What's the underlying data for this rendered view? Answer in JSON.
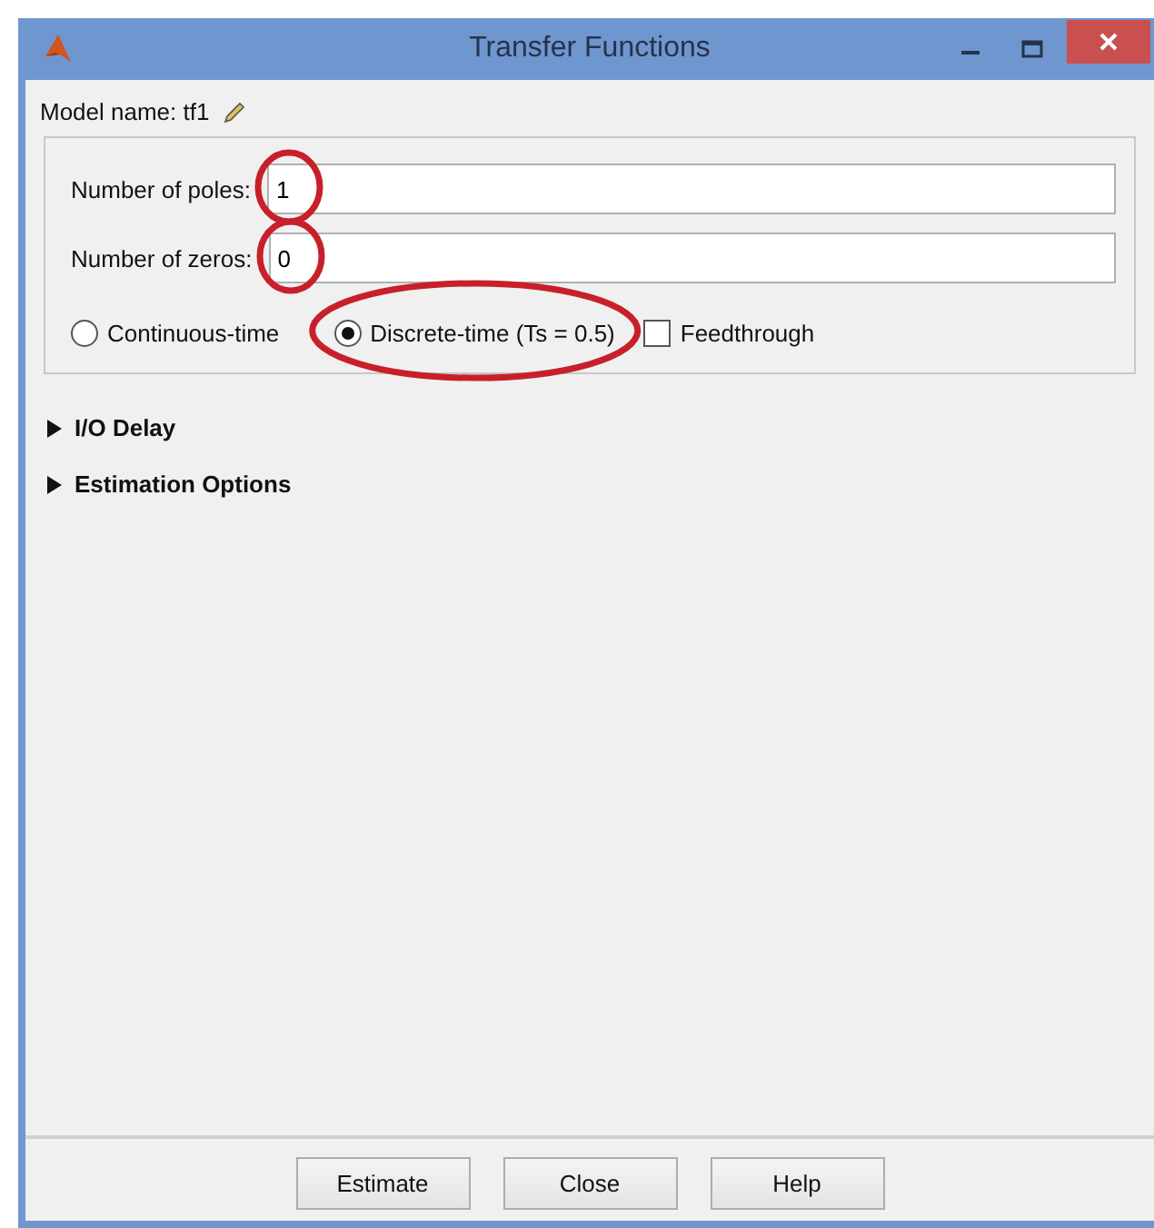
{
  "window": {
    "title": "Transfer Functions"
  },
  "model_name": {
    "label": "Model name: tf1"
  },
  "fields": [
    {
      "label": "Number of poles:",
      "value": "1"
    },
    {
      "label": "Number of zeros:",
      "value": "0"
    }
  ],
  "time_options": [
    {
      "label": "Continuous-time",
      "selected": false
    },
    {
      "label": "Discrete-time (Ts = 0.5)",
      "selected": true
    }
  ],
  "feedthrough": {
    "label": "Feedthrough",
    "checked": false
  },
  "sections": [
    {
      "label": "I/O Delay",
      "expanded": false
    },
    {
      "label": "Estimation Options",
      "expanded": false
    }
  ],
  "buttons": [
    "Estimate",
    "Close",
    "Help"
  ]
}
